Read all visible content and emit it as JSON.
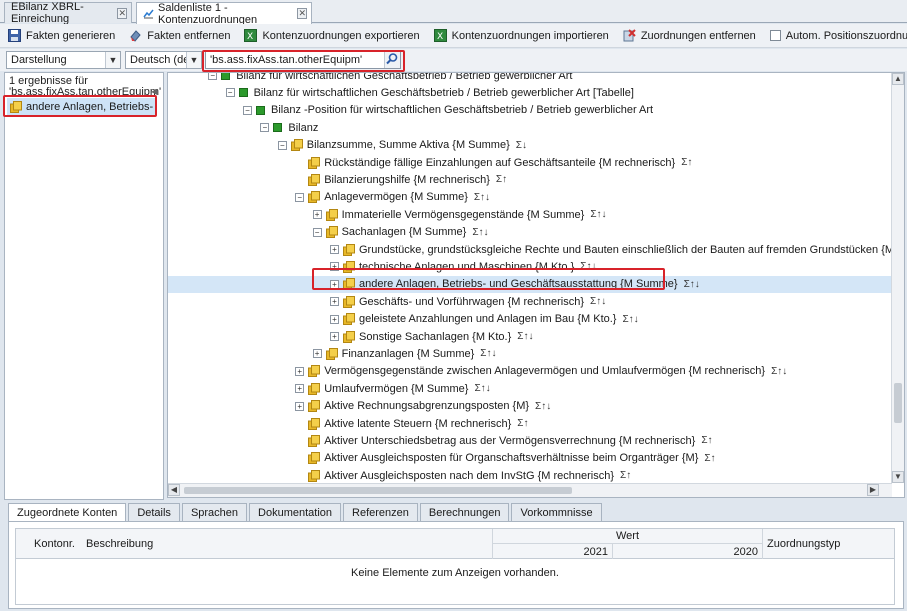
{
  "tabs": [
    {
      "label": "EBilanz XBRL-Einreichung"
    },
    {
      "label": "Saldenliste 1 - Kontenzuordnungen"
    }
  ],
  "toolbar": {
    "generate": "Fakten generieren",
    "remove": "Fakten entfernen",
    "export": "Kontenzuordnungen exportieren",
    "import": "Kontenzuordnungen importieren",
    "remove_assign": "Zuordnungen entfernen",
    "auto_position": "Autom. Positionszuordnung"
  },
  "filter": {
    "view": "Darstellung",
    "language": "Deutsch (de)",
    "search_value": "'bs.ass.fixAss.tan.otherEquipm'"
  },
  "left": {
    "result_line1": "1 ergebnisse für",
    "result_line2": "'bs.ass.fixAss.tan.otherEquipm'",
    "result_item": "andere Anlagen, Betriebs- und Geschäftsausstattung"
  },
  "tree": [
    {
      "label": "Bilanz für wirtschaftlichen Geschäftsbetrieb / Betrieb gewerblicher Art",
      "level": 3,
      "icon": "green-square",
      "exp": "minus",
      "sigma": ""
    },
    {
      "label": "Bilanz für wirtschaftlichen Geschäftsbetrieb / Betrieb gewerblicher Art [Tabelle]",
      "level": 4,
      "icon": "green-square",
      "exp": "minus",
      "sigma": ""
    },
    {
      "label": "Bilanz -Position für wirtschaftlichen Geschäftsbetrieb / Betrieb gewerblicher Art",
      "level": 5,
      "icon": "green-square",
      "exp": "minus",
      "sigma": ""
    },
    {
      "label": "Bilanz",
      "level": 6,
      "icon": "green-square",
      "exp": "minus",
      "sigma": ""
    },
    {
      "label": "Bilanzsumme, Summe Aktiva {M Summe}",
      "level": 7,
      "icon": "folder",
      "exp": "minus",
      "sigma": "Σ↓"
    },
    {
      "label": "Rückständige fällige Einzahlungen auf Geschäftsanteile {M rechnerisch}",
      "level": 8,
      "icon": "folder",
      "exp": "",
      "sigma": "Σ↑"
    },
    {
      "label": "Bilanzierungshilfe {M rechnerisch}",
      "level": 8,
      "icon": "folder",
      "exp": "",
      "sigma": "Σ↑"
    },
    {
      "label": "Anlagevermögen {M Summe}",
      "level": 8,
      "icon": "folder",
      "exp": "minus",
      "sigma": "Σ↑↓"
    },
    {
      "label": "Immaterielle Vermögensgegenstände {M Summe}",
      "level": 9,
      "icon": "folder",
      "exp": "plus",
      "sigma": "Σ↑↓"
    },
    {
      "label": "Sachanlagen {M Summe}",
      "level": 9,
      "icon": "folder",
      "exp": "minus",
      "sigma": "Σ↑↓"
    },
    {
      "label": "Grundstücke, grundstücksgleiche Rechte und Bauten einschließlich der Bauten auf fremden Grundstücken {M Summe}",
      "level": 10,
      "icon": "folder",
      "exp": "plus",
      "sigma": "Σ↑↓"
    },
    {
      "label": "technische Anlagen und Maschinen {M Kto.}",
      "level": 10,
      "icon": "folder",
      "exp": "plus",
      "sigma": "Σ↑↓"
    },
    {
      "label": "andere Anlagen, Betriebs- und Geschäftsausstattung {M Summe}",
      "level": 10,
      "icon": "folder",
      "exp": "plus",
      "sigma": "Σ↑↓",
      "selected": true
    },
    {
      "label": "Geschäfts- und Vorführwagen {M rechnerisch}",
      "level": 10,
      "icon": "folder",
      "exp": "plus",
      "sigma": "Σ↑↓"
    },
    {
      "label": "geleistete Anzahlungen und Anlagen im Bau {M Kto.}",
      "level": 10,
      "icon": "folder",
      "exp": "plus",
      "sigma": "Σ↑↓"
    },
    {
      "label": "Sonstige Sachanlagen {M Kto.}",
      "level": 10,
      "icon": "folder",
      "exp": "plus",
      "sigma": "Σ↑↓"
    },
    {
      "label": "Finanzanlagen {M Summe}",
      "level": 9,
      "icon": "folder",
      "exp": "plus",
      "sigma": "Σ↑↓"
    },
    {
      "label": "Vermögensgegenstände zwischen Anlagevermögen und Umlaufvermögen {M rechnerisch}",
      "level": 8,
      "icon": "folder",
      "exp": "plus",
      "sigma": "Σ↑↓"
    },
    {
      "label": "Umlaufvermögen {M Summe}",
      "level": 8,
      "icon": "folder",
      "exp": "plus",
      "sigma": "Σ↑↓"
    },
    {
      "label": "Aktive Rechnungsabgrenzungsposten {M}",
      "level": 8,
      "icon": "folder",
      "exp": "plus",
      "sigma": "Σ↑↓"
    },
    {
      "label": "Aktive latente Steuern {M rechnerisch}",
      "level": 8,
      "icon": "folder",
      "exp": "",
      "sigma": "Σ↑"
    },
    {
      "label": "Aktiver Unterschiedsbetrag aus der Vermögensverrechnung {M rechnerisch}",
      "level": 8,
      "icon": "folder",
      "exp": "",
      "sigma": "Σ↑"
    },
    {
      "label": "Aktiver Ausgleichsposten für Organschaftsverhältnisse beim Organträger {M}",
      "level": 8,
      "icon": "folder",
      "exp": "",
      "sigma": "Σ↑"
    },
    {
      "label": "Aktiver Ausgleichsposten nach dem InvStG {M rechnerisch}",
      "level": 8,
      "icon": "folder",
      "exp": "",
      "sigma": "Σ↑"
    }
  ],
  "bottom": {
    "tabs": [
      "Zugeordnete Konten",
      "Details",
      "Sprachen",
      "Dokumentation",
      "Referenzen",
      "Berechnungen",
      "Vorkommnisse"
    ],
    "col_konto": "Kontonr.",
    "col_desc": "Beschreibung",
    "col_wert": "Wert",
    "col_2021": "2021",
    "col_2020": "2020",
    "col_typ": "Zuordnungstyp",
    "empty": "Keine Elemente zum Anzeigen vorhanden."
  },
  "colors": {
    "folder": "#e8b828",
    "green": "#2c9a2c",
    "highlight": "#d8232a",
    "selected": "#d4e6f7"
  }
}
